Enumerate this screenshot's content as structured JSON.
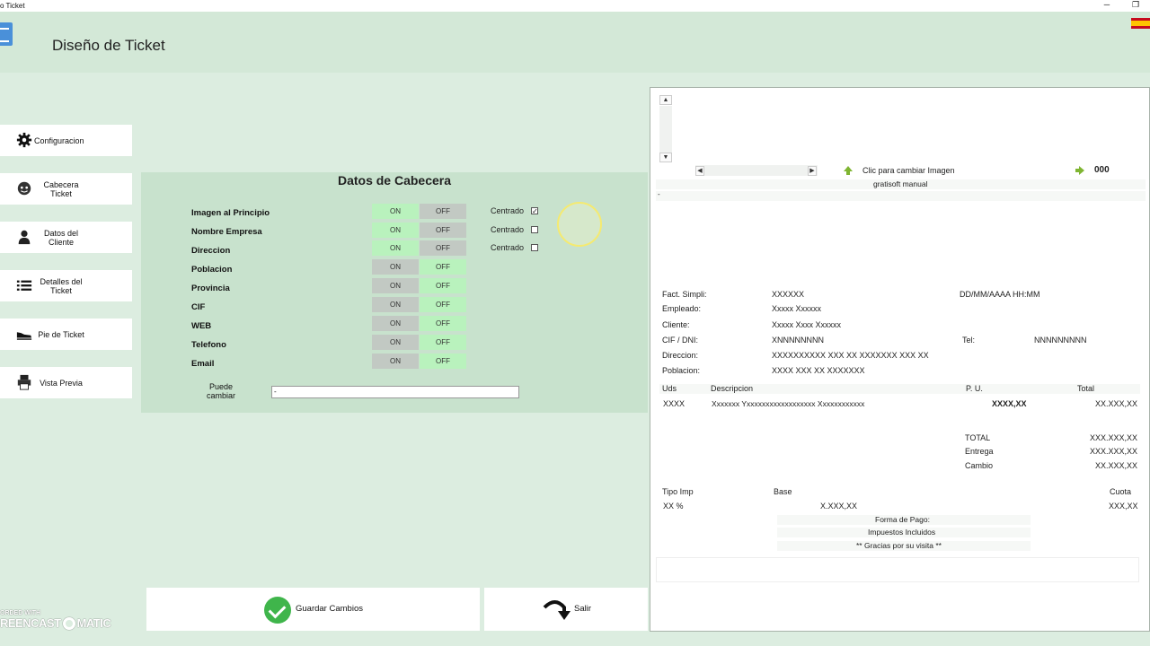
{
  "window": {
    "title": "o Ticket",
    "minimize_glyph": "─",
    "restore_glyph": "❐"
  },
  "header": {
    "title": "Diseño de Ticket",
    "flag_icon": "spain-flag-icon"
  },
  "sidebar": {
    "items": [
      {
        "label": "Configuracion",
        "icon": "gear-icon"
      },
      {
        "label": "Cabecera Ticket",
        "icon": "face-icon"
      },
      {
        "label": "Datos del Cliente",
        "icon": "person-icon"
      },
      {
        "label": "Detalles del Ticket",
        "icon": "list-icon"
      },
      {
        "label": "Pie de Ticket",
        "icon": "shoe-icon"
      },
      {
        "label": "Vista Previa",
        "icon": "printer-icon"
      }
    ]
  },
  "panel": {
    "title": "Datos de Cabecera",
    "on_label": "ON",
    "off_label": "OFF",
    "centrado_label": "Centrado",
    "rows": [
      {
        "label": "Imagen al Principio",
        "state": "ON",
        "centrado": true
      },
      {
        "label": "Nombre Empresa",
        "state": "ON",
        "centrado": false
      },
      {
        "label": "Direccion",
        "state": "ON",
        "centrado": false
      },
      {
        "label": "Poblacion",
        "state": "OFF"
      },
      {
        "label": "Provincia",
        "state": "OFF"
      },
      {
        "label": "CIF",
        "state": "OFF"
      },
      {
        "label": "WEB",
        "state": "OFF"
      },
      {
        "label": "Telefono",
        "state": "OFF"
      },
      {
        "label": "Email",
        "state": "OFF"
      }
    ],
    "puede_cambiar_label": "Puede cambiar",
    "puede_cambiar_value": "-"
  },
  "buttons": {
    "save": "Guardar Cambios",
    "exit": "Salir"
  },
  "preview": {
    "image_hint": "Clic para cambiar Imagen",
    "counter": "000",
    "company": "gratisoft manual",
    "dash": "-",
    "fact_simpli_label": "Fact. Simpli:",
    "fact_simpli_value": "XXXXXX",
    "date_time": "DD/MM/AAAA  HH:MM",
    "empleado_label": "Empleado:",
    "empleado_value": "Xxxxx Xxxxxx",
    "cliente_label": "Cliente:",
    "cliente_value": "Xxxxx Xxxx Xxxxxx",
    "cif_label": "CIF / DNI:",
    "cif_value": "XNNNNNNNN",
    "tel_label": "Tel:",
    "tel_value": "NNNNNNNNN",
    "direccion_label": "Direccion:",
    "direccion_value": "XXXXXXXXXX XXX XX XXXXXXX XXX XX",
    "poblacion_label": "Poblacion:",
    "poblacion_value": "XXXX XXX XX XXXXXXX",
    "col_uds": "Uds",
    "col_desc": "Descripcion",
    "col_pu": "P. U.",
    "col_total": "Total",
    "line_uds": "XXXX",
    "line_desc": "Xxxxxxx Yxxxxxxxxxxxxxxxxxx Xxxxxxxxxxxx",
    "line_pu": "XXXX,XX",
    "line_total": "XX.XXX,XX",
    "total_label": "TOTAL",
    "total_value": "XXX.XXX,XX",
    "entrega_label": "Entrega",
    "entrega_value": "XXX.XXX,XX",
    "cambio_label": "Cambio",
    "cambio_value": "XX.XXX,XX",
    "tipo_imp_label": "Tipo Imp",
    "base_label": "Base",
    "cuota_label": "Cuota",
    "tipo_imp_value": "XX %",
    "base_value": "X.XXX,XX",
    "cuota_value": "XXX,XX",
    "forma_pago": "Forma de Pago:",
    "impuestos": "Impuestos Incluidos",
    "gracias": "** Gracias por su visita **",
    "scroll_up": "▲",
    "scroll_down": "▼",
    "scroll_left": "◀",
    "scroll_right": "▶"
  },
  "watermark": {
    "line1": "ORDED WITH",
    "line2": "REENCAST",
    "line3": "MATIC"
  }
}
